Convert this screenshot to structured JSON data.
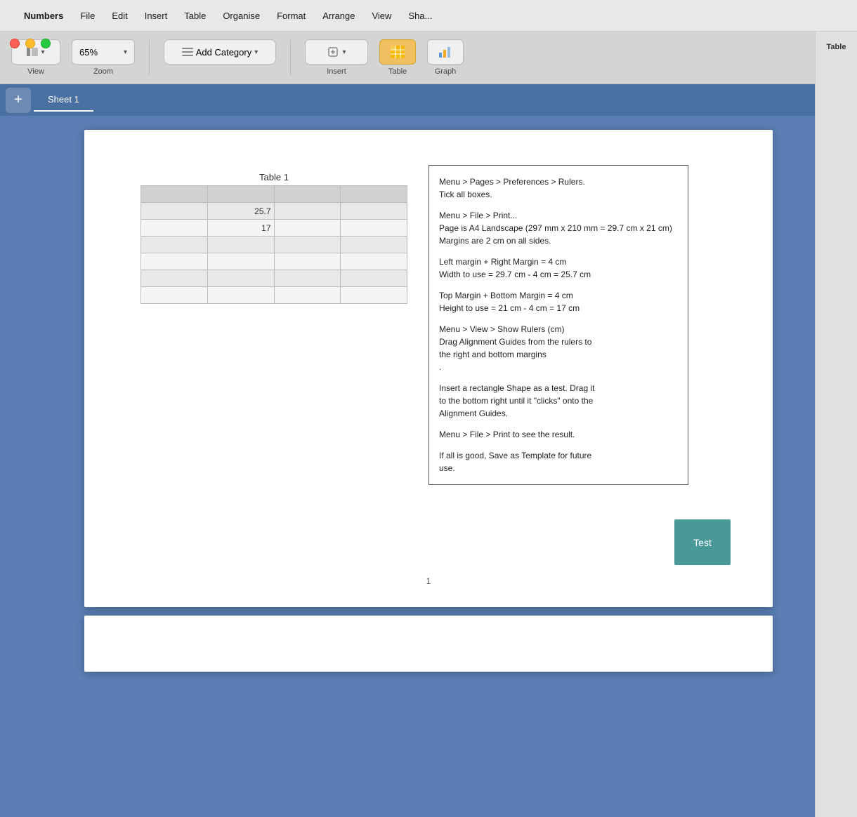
{
  "app": {
    "name": "Numbers",
    "title": "Numbers"
  },
  "menubar": {
    "apple_symbol": "",
    "items": [
      {
        "label": "Numbers",
        "id": "numbers"
      },
      {
        "label": "File",
        "id": "file"
      },
      {
        "label": "Edit",
        "id": "edit"
      },
      {
        "label": "Insert",
        "id": "insert"
      },
      {
        "label": "Table",
        "id": "table"
      },
      {
        "label": "Organise",
        "id": "organise"
      },
      {
        "label": "Format",
        "id": "format"
      },
      {
        "label": "Arrange",
        "id": "arrange"
      },
      {
        "label": "View",
        "id": "view"
      },
      {
        "label": "Sha...",
        "id": "share"
      }
    ]
  },
  "toolbar": {
    "view_label": "View",
    "zoom_value": "65%",
    "zoom_label": "Zoom",
    "add_category_label": "Add Category",
    "insert_label": "Insert",
    "table_label": "Table",
    "graph_label": "Graph"
  },
  "sheet": {
    "add_button": "+",
    "active_tab": "Sheet 1"
  },
  "spreadsheet": {
    "table_title": "Table 1",
    "rows": [
      [
        "",
        "",
        "",
        ""
      ],
      [
        "",
        "25.7",
        "",
        ""
      ],
      [
        "",
        "17",
        "",
        ""
      ],
      [
        "",
        "",
        "",
        ""
      ],
      [
        "",
        "",
        "",
        ""
      ],
      [
        "",
        "",
        "",
        ""
      ],
      [
        "",
        "",
        "",
        ""
      ]
    ]
  },
  "textbox": {
    "lines": [
      "Menu > Pages > Preferences > Rulers.",
      "Tick all boxes.",
      "",
      "Menu > File > Print...",
      "Page is A4 Landscape (297 mm x 210 mm = 29.7 cm x 21 cm)",
      "Margins are 2 cm on all sides.",
      "",
      "Left margin + Right Margin = 4 cm",
      "Width to use = 29.7 cm - 4 cm = 25.7 cm",
      "",
      "Top Margin + Bottom Margin = 4 cm",
      "Height to use = 21 cm - 4 cm = 17 cm",
      "",
      "Menu > View > Show Rulers (cm)",
      "Drag Alignment Guides from the rulers to",
      "the right and bottom margins",
      ".",
      "",
      "Insert a rectangle Shape as a test. Drag it",
      "to the bottom right until it \"clicks\" onto the",
      "Alignment Guides.",
      "",
      "Menu > File > Print to see the result.",
      "",
      "If all is good, Save as Template for future",
      "use."
    ]
  },
  "test_shape": {
    "label": "Test"
  },
  "page_number": "1",
  "right_panel": {
    "tab_label": "Table"
  }
}
